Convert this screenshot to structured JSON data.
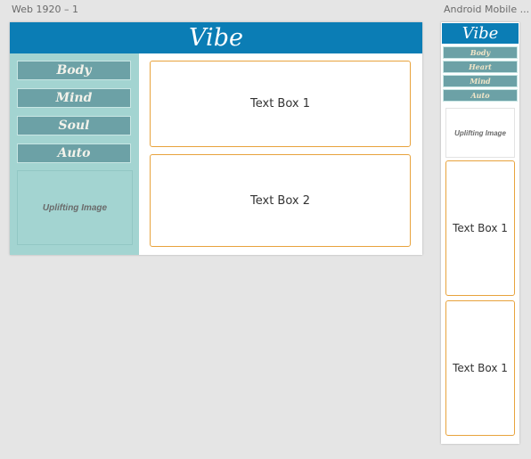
{
  "canvas": {
    "background": "#e5e5e5"
  },
  "artboards": [
    {
      "label": "Web 1920 – 1",
      "header": {
        "brand": "Vibe",
        "color": "#0b7db5"
      },
      "sidebar": {
        "color": "#a3d4d1",
        "nav": [
          {
            "label": "Body"
          },
          {
            "label": "Mind"
          },
          {
            "label": "Soul"
          },
          {
            "label": "Auto"
          }
        ],
        "image_placeholder": "Uplifting Image"
      },
      "main": {
        "text_boxes": [
          {
            "label": "Text Box 1"
          },
          {
            "label": "Text Box 2"
          }
        ]
      }
    },
    {
      "label": "Android Mobile ...",
      "header": {
        "brand": "Vibe",
        "color": "#0b7db5"
      },
      "nav": [
        {
          "label": "Body"
        },
        {
          "label": "Heart"
        },
        {
          "label": "Mind"
        },
        {
          "label": "Auto"
        }
      ],
      "image_placeholder": "Uplifting Image",
      "text_boxes": [
        {
          "label": "Text Box 1"
        },
        {
          "label": "Text Box 1"
        }
      ]
    }
  ],
  "colors": {
    "nav_button": "#6ca1a6",
    "text_box_border": "#e8a33d"
  }
}
